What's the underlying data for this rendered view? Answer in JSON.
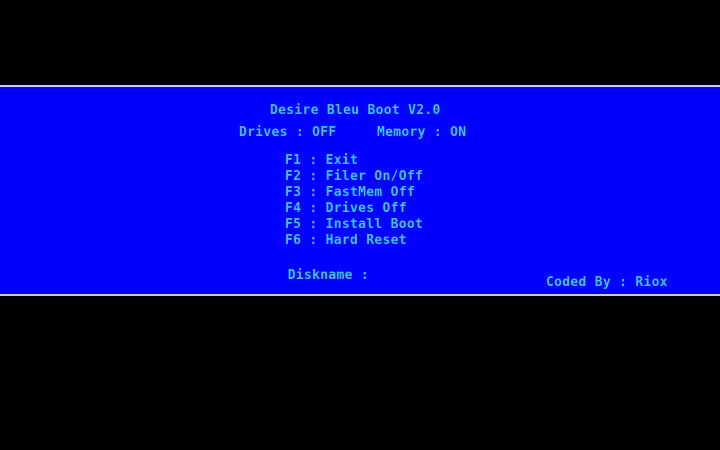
{
  "colors": {
    "background": "#000000",
    "panel": "#0000FF",
    "text": "#38C8FF",
    "border": "#C8C8FF"
  },
  "title": "Desire Bleu Boot V2.0",
  "status": {
    "drives": "Drives : OFF",
    "memory": "Memory : ON"
  },
  "menu": [
    {
      "label": "F1 : Exit"
    },
    {
      "label": "F2 : Filer On/Off"
    },
    {
      "label": "F3 : FastMem Off"
    },
    {
      "label": "F4 : Drives Off"
    },
    {
      "label": "F5 : Install Boot"
    },
    {
      "label": "F6 : Hard Reset"
    }
  ],
  "diskname": {
    "label": "Diskname :",
    "value": ""
  },
  "credit": "Coded By : Riox"
}
